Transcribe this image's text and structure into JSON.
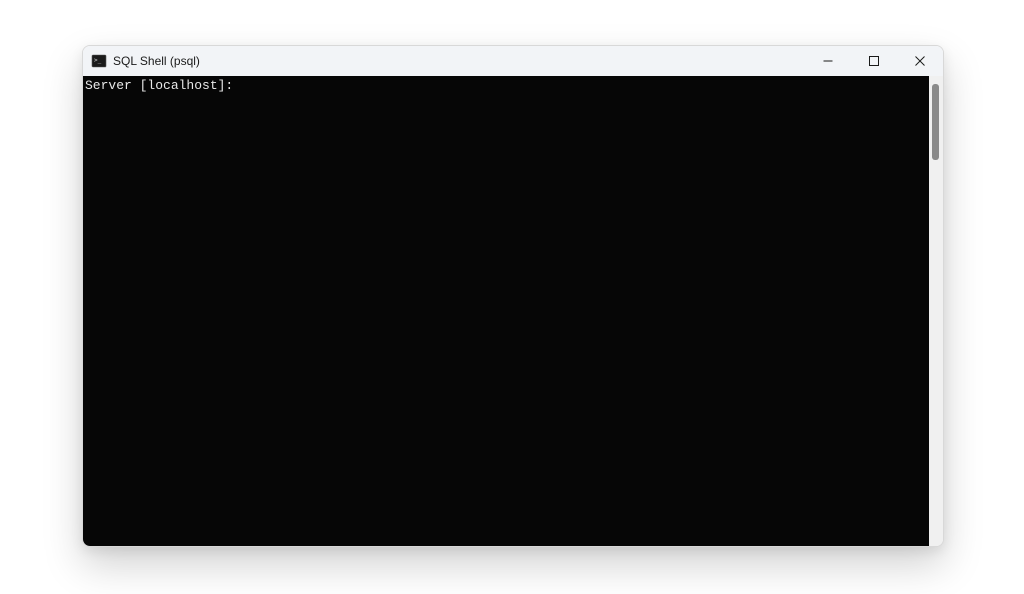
{
  "window": {
    "title": "SQL Shell (psql)",
    "icon": "terminal-icon"
  },
  "terminal": {
    "prompt": "Server [localhost]:"
  },
  "controls": {
    "minimize": "minimize",
    "maximize": "maximize",
    "close": "close"
  }
}
